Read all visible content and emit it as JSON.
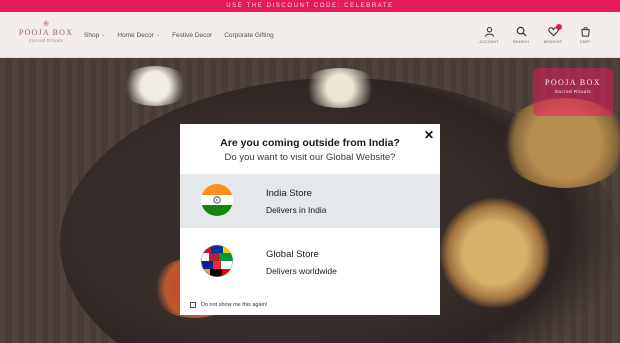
{
  "announcement": "USE THE DISCOUNT CODE: CELEBRATE",
  "brand": {
    "name": "POOJA BOX",
    "tagline": "Sacred Rituals",
    "accent": "#e6195d"
  },
  "nav": {
    "items": [
      {
        "label": "Shop",
        "has_dropdown": true
      },
      {
        "label": "Home Decor",
        "has_dropdown": true
      },
      {
        "label": "Festive Decor",
        "has_dropdown": false
      },
      {
        "label": "Corporate Gifting",
        "has_dropdown": false
      }
    ],
    "icons": [
      {
        "name": "account-icon",
        "label": "ACCOUNT"
      },
      {
        "name": "search-icon",
        "label": "SEARCH"
      },
      {
        "name": "wishlist-icon",
        "label": "WISHLIST"
      },
      {
        "name": "cart-icon",
        "label": "CART"
      }
    ]
  },
  "modal": {
    "title": "Are you coming outside from India?",
    "subtitle": "Do you want to visit our Global Website?",
    "close_glyph": "✕",
    "stores": [
      {
        "name": "India Store",
        "description": "Delivers in India",
        "selected": true,
        "flag": "india-flag-icon"
      },
      {
        "name": "Global Store",
        "description": "Delivers worldwide",
        "selected": false,
        "flag": "world-flags-icon"
      }
    ],
    "dont_show_label": "Do not show me this again!",
    "dont_show_checked": false
  }
}
